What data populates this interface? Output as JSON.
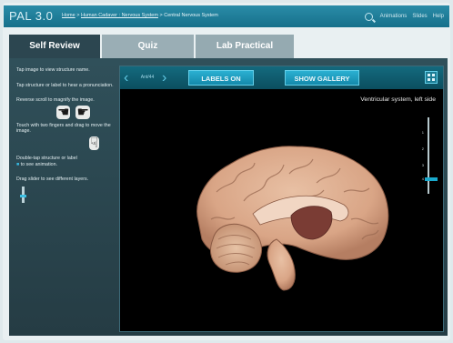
{
  "app": {
    "logo": "PAL 3.0",
    "breadcrumb": {
      "home": "Home",
      "sep1": " > ",
      "section": "Human Cadaver : Nervous System",
      "sep2": " > ",
      "current": "Central Nervous System"
    },
    "actions": [
      "Animations",
      "Slides",
      "Help"
    ]
  },
  "tabs": [
    {
      "label": "Self Review",
      "active": true
    },
    {
      "label": "Quiz",
      "active": false
    },
    {
      "label": "Lab Practical",
      "active": false
    }
  ],
  "instructions": {
    "tap_view": "Tap image to view structure name.",
    "tap_label": "Tap structure or label to hear a pronunciation.",
    "zoom": "Reverse scroll to magnify the image.",
    "drag": "Touch with two fingers and drag to move the image.",
    "double_tap": "Double-tap structure or label",
    "double_tap_hint": "to see animation.",
    "slider": "Drag slider to see different layers."
  },
  "viewer": {
    "view_label": "Ant/44",
    "labels_button": "LABELS ON",
    "gallery_button": "SHOW GALLERY",
    "caption": "Ventricular system, left side",
    "layer_ticks": [
      "1",
      "2",
      "3",
      "4"
    ],
    "layer_value": 4
  },
  "colors": {
    "header": "#1f7f9a",
    "accent": "#1aa8cd",
    "panel": "#2d4953"
  }
}
